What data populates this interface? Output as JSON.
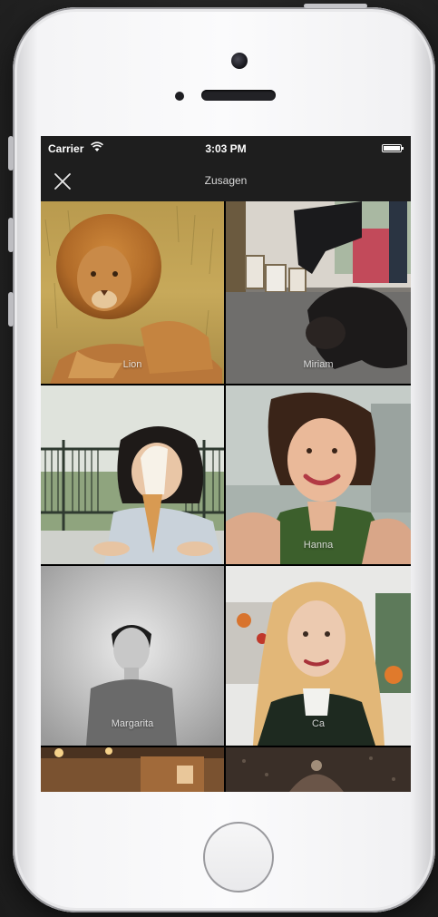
{
  "status_bar": {
    "carrier": "Carrier",
    "time": "3:03 PM",
    "wifi_icon": "wifi-icon",
    "battery_icon": "battery-icon"
  },
  "nav": {
    "title": "Zusagen",
    "close_icon": "close-icon"
  },
  "photos": [
    {
      "label": "Lion",
      "subject": "lion-photo"
    },
    {
      "label": "Miriam",
      "subject": "dog-photo"
    },
    {
      "label": "",
      "subject": "girl-with-ice-cream-photo"
    },
    {
      "label": "Hanna",
      "subject": "smiling-woman-photo"
    },
    {
      "label": "Margarita",
      "subject": "person-portrait-photo"
    },
    {
      "label": "Ca",
      "subject": "blonde-woman-photo"
    },
    {
      "label": "",
      "subject": "interior-photo"
    },
    {
      "label": "",
      "subject": "dark-photo"
    }
  ],
  "colors": {
    "bar_background": "#1e1e1e",
    "phone_body": "#f4f4f6"
  }
}
